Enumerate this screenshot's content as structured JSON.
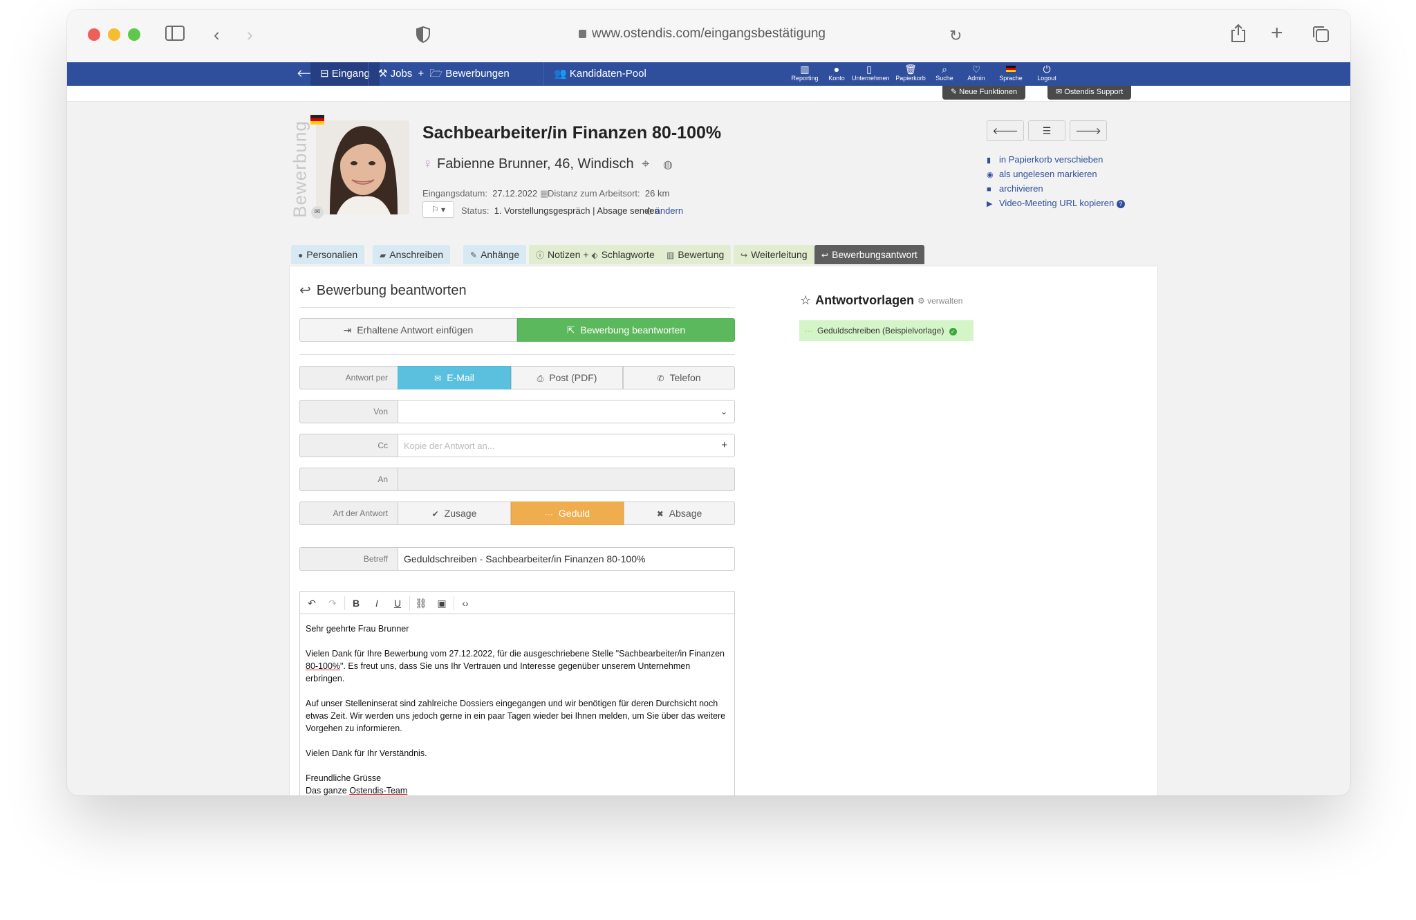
{
  "browser": {
    "url": "www.ostendis.com/eingangsbestätigung"
  },
  "nav": {
    "items": [
      "Eingang",
      "Jobs",
      "Bewerbungen",
      "Kandidaten-Pool"
    ],
    "plus": "+",
    "tools": [
      "Reporting",
      "Konto",
      "Unternehmen",
      "Papierkorb",
      "Suche",
      "Admin",
      "Sprache",
      "Logout"
    ],
    "pills": [
      "Neue Funktionen",
      "Ostendis Support"
    ]
  },
  "header": {
    "vertical_label": "Bewerbung",
    "job_title": "Sachbearbeiter/in Finanzen 80-100%",
    "candidate": "Fabienne Brunner, 46, Windisch",
    "received_label": "Eingangsdatum:",
    "received_date": "27.12.2022",
    "distance_label": "Distanz zum Arbeitsort:",
    "distance": "26 km",
    "status_label": "Status:",
    "status": "1. Vorstellungsgespräch | Absage senden",
    "change": "ändern"
  },
  "side_links": [
    "in Papierkorb verschieben",
    "als ungelesen markieren",
    "archivieren",
    "Video-Meeting URL kopieren"
  ],
  "tabs": [
    "Personalien",
    "Anschreiben",
    "Anhänge",
    "Notizen",
    "+",
    "Schlagworte",
    "Bewertung",
    "Weiterleitung",
    "Bewerbungsantwort"
  ],
  "form": {
    "section_title": "Bewerbung beantworten",
    "btn_insert": "Erhaltene Antwort einfügen",
    "btn_answer": "Bewerbung beantworten",
    "answer_via_label": "Antwort per",
    "answer_via": [
      "E-Mail",
      "Post (PDF)",
      "Telefon"
    ],
    "from_label": "Von",
    "cc_label": "Cc",
    "cc_placeholder": "Kopie der Antwort an...",
    "to_label": "An",
    "type_label": "Art der Antwort",
    "types": [
      "Zusage",
      "Geduld",
      "Absage"
    ],
    "subject_label": "Betreff",
    "subject": "Geduldschreiben - Sachbearbeiter/in Finanzen 80-100%"
  },
  "letter": {
    "greeting": "Sehr geehrte Frau Brunner",
    "p1_a": "Vielen Dank für Ihre Bewerbung vom 27.12.2022, für die ausgeschriebene Stelle \"Sachbearbeiter/in Finanzen ",
    "p1_b": "80-100%",
    "p1_c": "\". Es freut uns, dass Sie uns Ihr Vertrauen und Interesse gegenüber unserem Unternehmen erbringen.",
    "p2": "Auf unser Stelleninserat sind zahlreiche Dossiers eingegangen und wir benötigen für deren Durchsicht noch etwas Zeit. Wir werden uns jedoch gerne in ein paar Tagen wieder bei Ihnen melden, um Sie über das weitere Vorgehen zu informieren.",
    "p3": "Vielen Dank für Ihr Verständnis.",
    "closing": "Freundliche Grüsse",
    "sign_a": "Das ganze ",
    "sign_b": "Ostendis-Team"
  },
  "templates": {
    "title": "Antwortvorlagen",
    "manage": "verwalten",
    "items": [
      "Geduldschreiben (Beispielvorlage)"
    ]
  },
  "colors": {
    "nav": "#2f4f9c",
    "success": "#5cb85c",
    "info": "#5bc0de",
    "warning": "#f0ad4e",
    "template_bg": "#d4f5c8"
  }
}
